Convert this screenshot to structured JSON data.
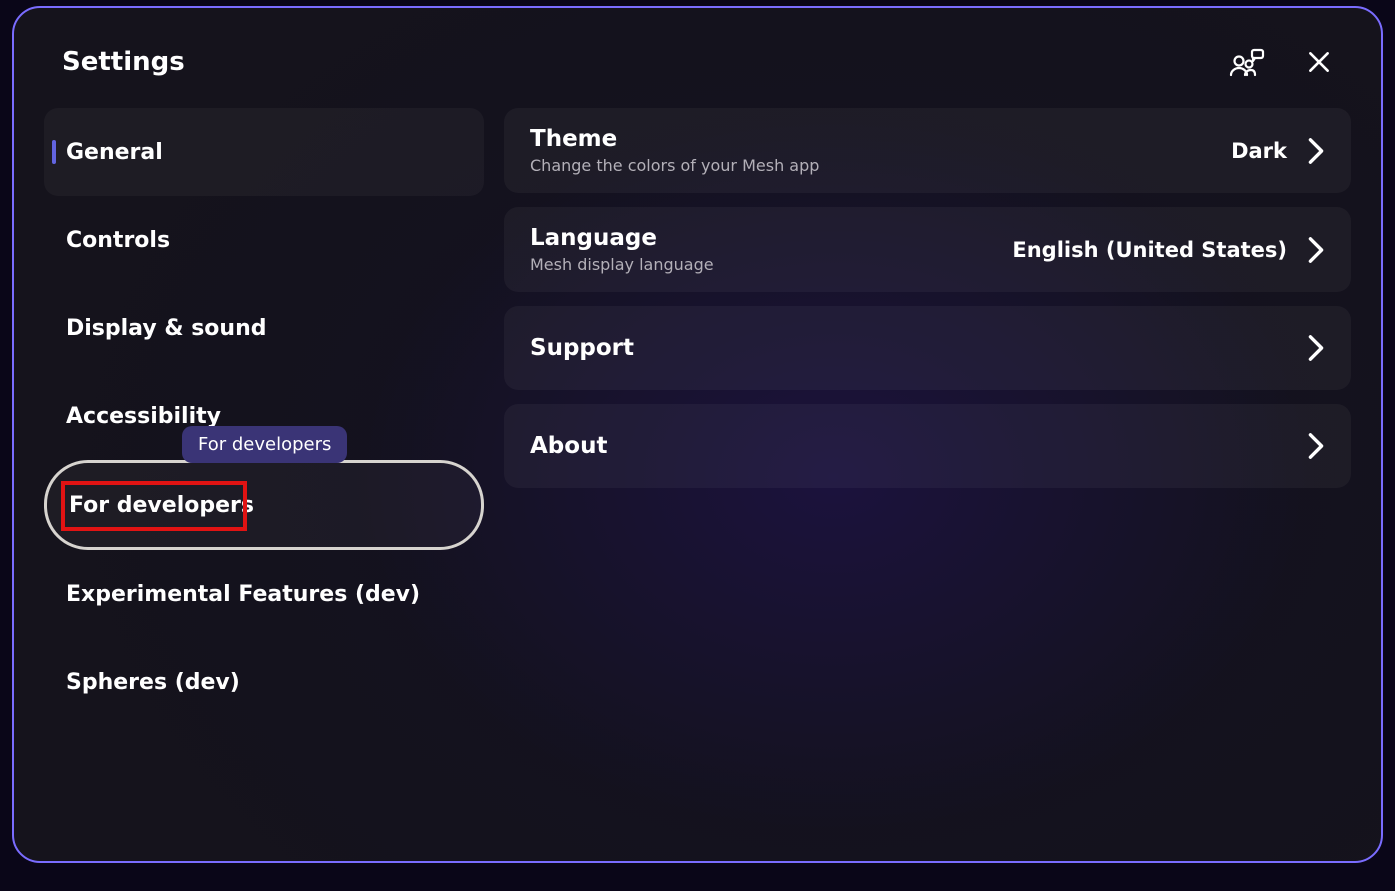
{
  "header": {
    "title": "Settings"
  },
  "sidebar": {
    "items": [
      {
        "label": "General",
        "active": true
      },
      {
        "label": "Controls"
      },
      {
        "label": "Display & sound"
      },
      {
        "label": "Accessibility"
      },
      {
        "label": "For developers",
        "focused": true
      },
      {
        "label": "Experimental Features (dev)"
      },
      {
        "label": "Spheres (dev)"
      }
    ]
  },
  "tooltip": {
    "text": "For developers"
  },
  "content": {
    "items": [
      {
        "label": "Theme",
        "desc": "Change the colors of your Mesh app",
        "value": "Dark"
      },
      {
        "label": "Language",
        "desc": "Mesh display language",
        "value": "English (United States)"
      },
      {
        "label": "Support"
      },
      {
        "label": "About"
      }
    ]
  }
}
